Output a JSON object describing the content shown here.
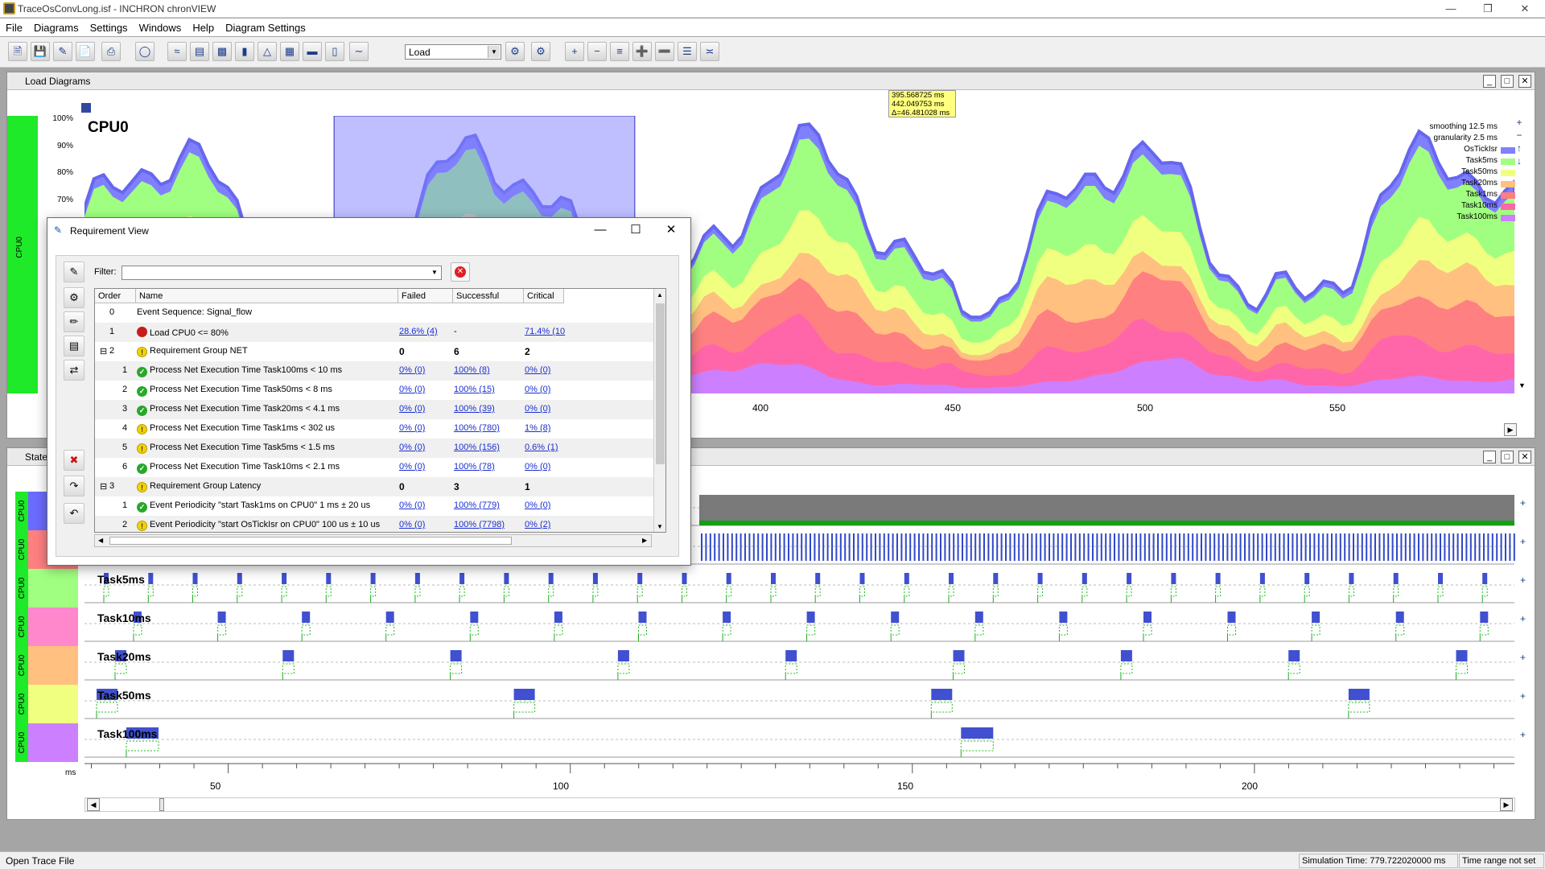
{
  "window": {
    "title": "TraceOsConvLong.isf  -  INCHRON chronVIEW"
  },
  "menu": [
    "File",
    "Diagrams",
    "Settings",
    "Windows",
    "Help",
    "Diagram Settings"
  ],
  "toolbar": {
    "load_select": "Load"
  },
  "load_panel": {
    "title": "Load Diagrams",
    "chart_title": "CPU0",
    "side_label": "CPU0",
    "y_ticks": [
      "100%",
      "90%",
      "80%",
      "70%"
    ],
    "x_ticks": [
      "400",
      "450",
      "500",
      "550"
    ],
    "tooltip": [
      "395.568725 ms",
      "442.049753 ms",
      "Δ=46.481028 ms"
    ],
    "legend": [
      {
        "label": "smoothing 12.5 ms"
      },
      {
        "label": "granularity 2.5 ms"
      },
      {
        "label": "OsTickIsr",
        "color": "#8080ff"
      },
      {
        "label": "Task5ms",
        "color": "#a0ff80"
      },
      {
        "label": "Task50ms",
        "color": "#f0ff80"
      },
      {
        "label": "Task20ms",
        "color": "#ffc080"
      },
      {
        "label": "Task1ms",
        "color": "#ff8080"
      },
      {
        "label": "Task10ms",
        "color": "#ff66aa"
      },
      {
        "label": "Task100ms",
        "color": "#cc80ff"
      }
    ],
    "selection": {
      "start_ms": 395.568725,
      "end_ms": 442.049753
    },
    "x_range": [
      357,
      578
    ]
  },
  "state_panel": {
    "title": "State",
    "unit": "ms",
    "x_ticks": [
      "50",
      "100",
      "150",
      "200"
    ],
    "x_range": [
      29,
      238
    ],
    "tasks": [
      {
        "name": "OsTickIsr",
        "cpu": "CPU0",
        "color": "#6b6bff",
        "labeled": false
      },
      {
        "name": "Task1ms",
        "cpu": "CPU0",
        "color": "#ff8080",
        "labeled": false
      },
      {
        "name": "Task5ms",
        "cpu": "CPU0",
        "color": "#a0ff80",
        "labeled": true
      },
      {
        "name": "Task10ms",
        "cpu": "CPU0",
        "color": "#ff88cc",
        "labeled": true
      },
      {
        "name": "Task20ms",
        "cpu": "CPU0",
        "color": "#ffc080",
        "labeled": true
      },
      {
        "name": "Task50ms",
        "cpu": "CPU0",
        "color": "#f0ff80",
        "labeled": true
      },
      {
        "name": "Task100ms",
        "cpu": "CPU0",
        "color": "#cc80ff",
        "labeled": true
      }
    ]
  },
  "requirement_view": {
    "title": "Requirement View",
    "filter_label": "Filter:",
    "filter_value": "",
    "columns": [
      "Order",
      "Name",
      "Failed",
      "Successful",
      "Critical"
    ],
    "rows": [
      {
        "order": "0",
        "name": "Event Sequence: Signal_flow",
        "failed": "",
        "successful": "",
        "critical": "",
        "icon": "none",
        "level": 0,
        "bold": false,
        "link": false
      },
      {
        "order": "1",
        "name": "Load CPU0 <= 80%",
        "failed": "28.6% (4)",
        "successful": "-",
        "critical": "71.4% (10",
        "icon": "red",
        "level": 0,
        "bold": false,
        "link": true
      },
      {
        "order": "2",
        "name": "Requirement Group NET",
        "failed": "0",
        "successful": "6",
        "critical": "2",
        "icon": "warn",
        "level": 0,
        "bold": true,
        "link": false,
        "expander": "⊟"
      },
      {
        "order": "1",
        "name": "Process Net Execution Time Task100ms < 10 ms",
        "failed": "0% (0)",
        "successful": "100% (8)",
        "critical": "0% (0)",
        "icon": "ok",
        "level": 1,
        "bold": false,
        "link": true
      },
      {
        "order": "2",
        "name": "Process Net Execution Time Task50ms < 8 ms",
        "failed": "0% (0)",
        "successful": "100% (15)",
        "critical": "0% (0)",
        "icon": "ok",
        "level": 1,
        "bold": false,
        "link": true
      },
      {
        "order": "3",
        "name": "Process Net Execution Time Task20ms < 4.1 ms",
        "failed": "0% (0)",
        "successful": "100% (39)",
        "critical": "0% (0)",
        "icon": "ok",
        "level": 1,
        "bold": false,
        "link": true
      },
      {
        "order": "4",
        "name": "Process Net Execution Time Task1ms < 302 us",
        "failed": "0% (0)",
        "successful": "100% (780)",
        "critical": "1% (8)",
        "icon": "warn",
        "level": 1,
        "bold": false,
        "link": true
      },
      {
        "order": "5",
        "name": "Process Net Execution Time Task5ms < 1.5 ms",
        "failed": "0% (0)",
        "successful": "100% (156)",
        "critical": "0.6% (1)",
        "icon": "warn",
        "level": 1,
        "bold": false,
        "link": true
      },
      {
        "order": "6",
        "name": "Process Net Execution Time Task10ms < 2.1 ms",
        "failed": "0% (0)",
        "successful": "100% (78)",
        "critical": "0% (0)",
        "icon": "ok",
        "level": 1,
        "bold": false,
        "link": true
      },
      {
        "order": "3",
        "name": "Requirement Group Latency",
        "failed": "0",
        "successful": "3",
        "critical": "1",
        "icon": "warn",
        "level": 0,
        "bold": true,
        "link": false,
        "expander": "⊟"
      },
      {
        "order": "1",
        "name": "Event Periodicity \"start Task1ms on CPU0\" 1 ms ± 20 us",
        "failed": "0% (0)",
        "successful": "100% (779)",
        "critical": "0% (0)",
        "icon": "ok",
        "level": 1,
        "bold": false,
        "link": true
      },
      {
        "order": "2",
        "name": "Event Periodicity \"start OsTickIsr on CPU0\" 100 us ± 10 us",
        "failed": "0% (0)",
        "successful": "100% (7798)",
        "critical": "0% (2)",
        "icon": "warn",
        "level": 1,
        "bold": false,
        "link": true
      }
    ]
  },
  "status_bar": {
    "left": "Open Trace File",
    "simulation_time": "Simulation Time: 779.722020000 ms",
    "time_range": "Time range not set"
  },
  "colors": {
    "cpu_bar": "#1eea2a",
    "selection": "#8080ff",
    "link": "#1a2fd0"
  }
}
